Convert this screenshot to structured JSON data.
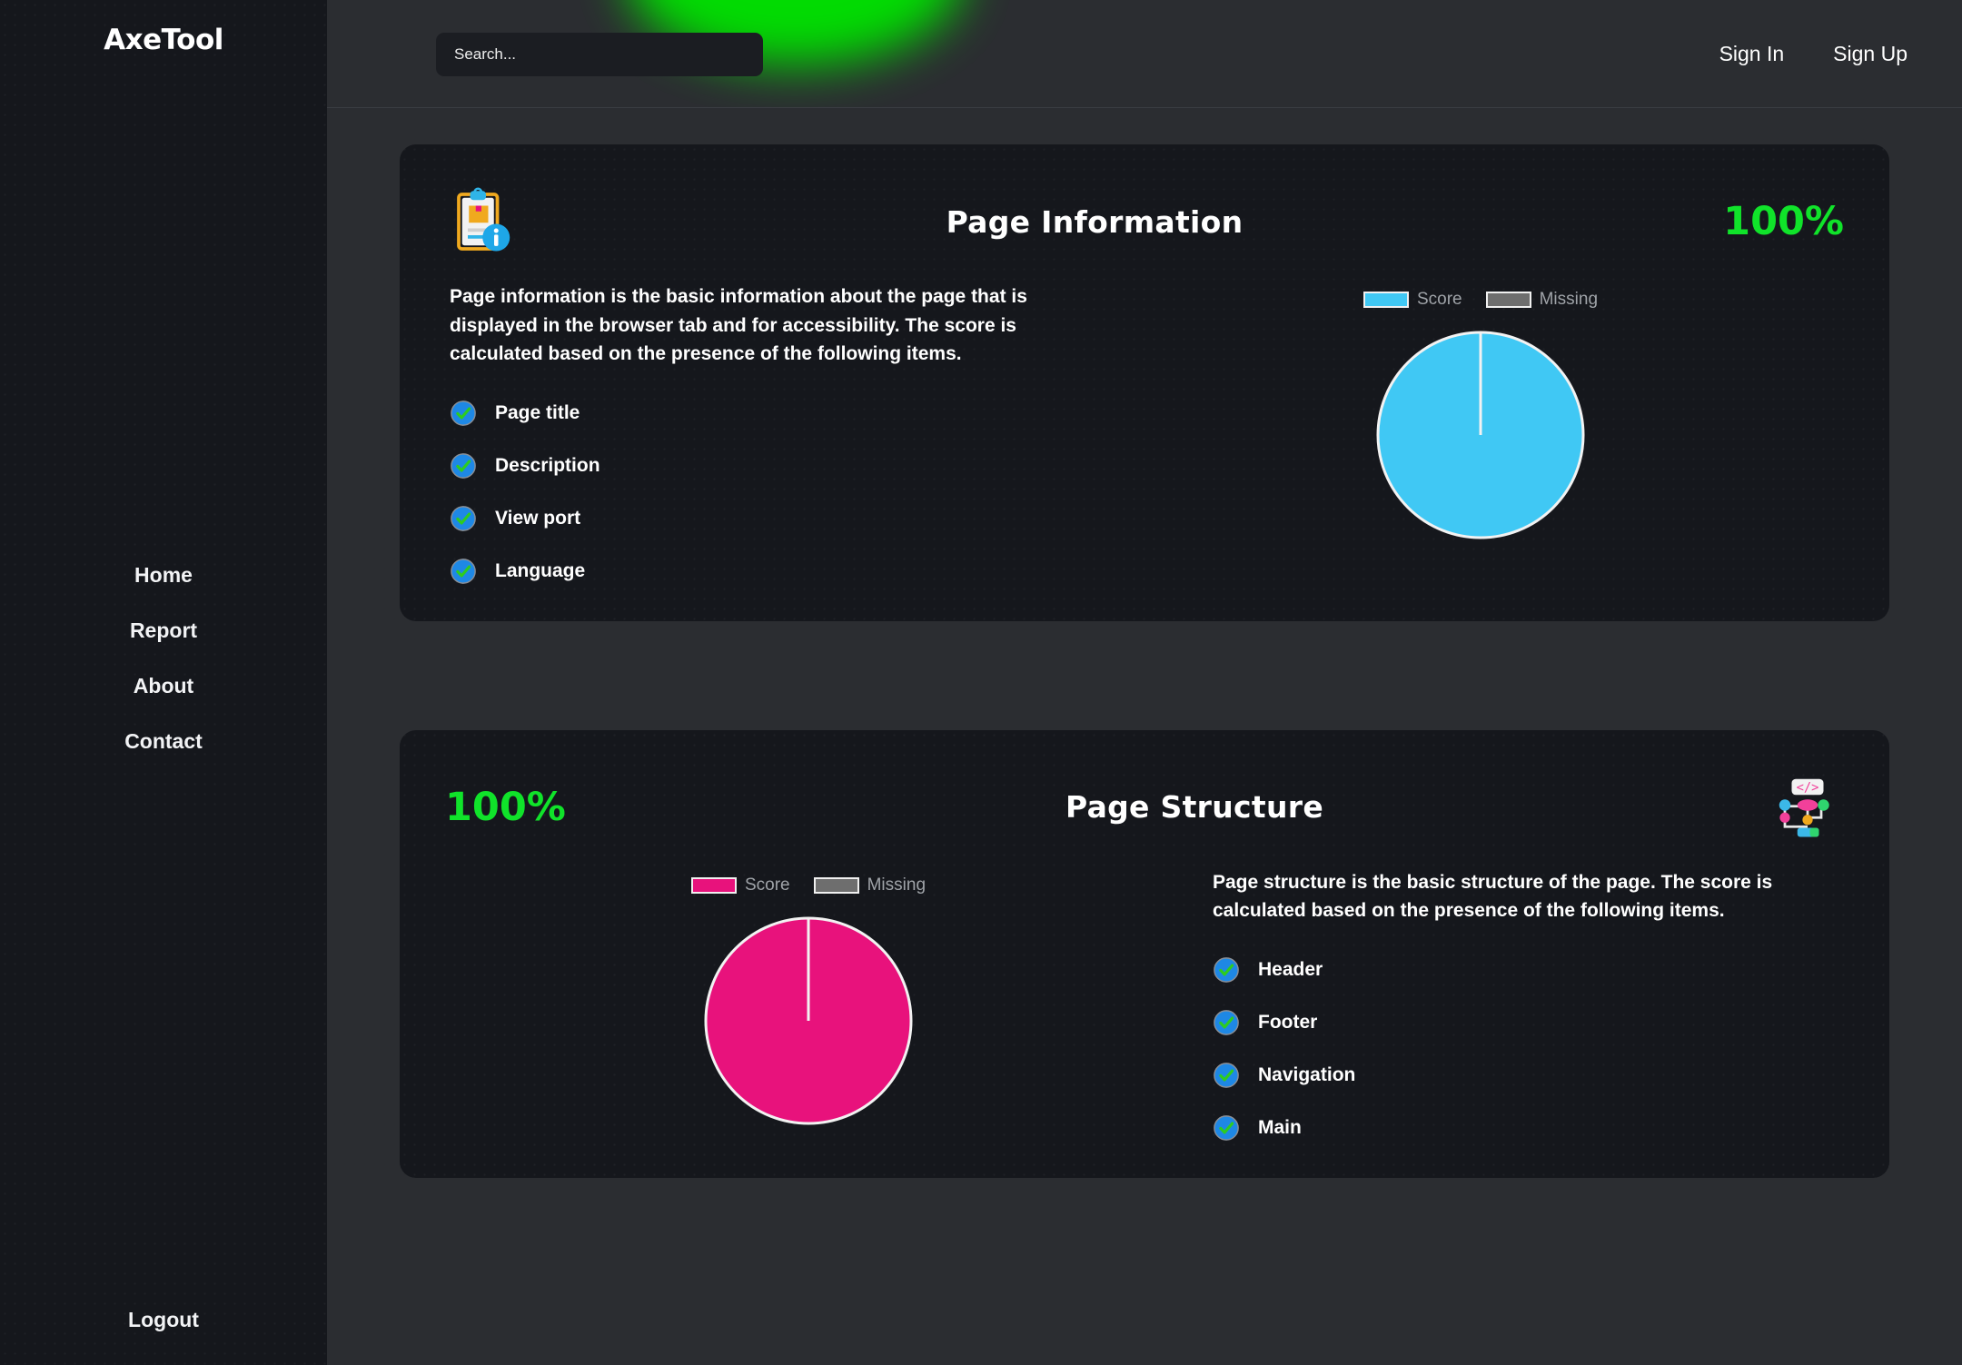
{
  "brand": {
    "name": "AxeTool"
  },
  "sidebar": {
    "items": [
      {
        "label": "Home",
        "name": "home"
      },
      {
        "label": "Report",
        "name": "report"
      },
      {
        "label": "About",
        "name": "about"
      },
      {
        "label": "Contact",
        "name": "contact"
      }
    ],
    "logout_label": "Logout"
  },
  "header": {
    "search": {
      "placeholder": "Search...",
      "value": ""
    },
    "sign_in_label": "Sign In",
    "sign_up_label": "Sign Up",
    "glow_color": "#00e500"
  },
  "colors": {
    "score_green": "#10e32a",
    "page_info_pie": "#40c8f4",
    "page_structure_pie": "#e8127c",
    "missing_gray": "#6e6e6e",
    "check_circle": "#1e88e5",
    "check_mark": "#2ecc1f"
  },
  "cards": [
    {
      "id": "page-information",
      "title": "Page Information",
      "score": "100%",
      "icon_name": "clipboard-info-icon",
      "description": "Page information is the basic information about the page that is displayed in the browser tab and for accessibility. The score is calculated based on the presence of the following items.",
      "items": [
        {
          "label": "Page title",
          "checked": true
        },
        {
          "label": "Description",
          "checked": true
        },
        {
          "label": "View port",
          "checked": true
        },
        {
          "label": "Language",
          "checked": true
        }
      ],
      "legend": [
        {
          "label": "Score",
          "color": "#40c8f4"
        },
        {
          "label": "Missing",
          "color": "#6e6e6e"
        }
      ]
    },
    {
      "id": "page-structure",
      "title": "Page Structure",
      "score": "100%",
      "icon_name": "sitemap-code-icon",
      "description": "Page structure is the basic structure of the page. The score is calculated based on the presence of the following items.",
      "items": [
        {
          "label": "Header",
          "checked": true
        },
        {
          "label": "Footer",
          "checked": true
        },
        {
          "label": "Navigation",
          "checked": true
        },
        {
          "label": "Main",
          "checked": true
        }
      ],
      "legend": [
        {
          "label": "Score",
          "color": "#e8127c"
        },
        {
          "label": "Missing",
          "color": "#6e6e6e"
        }
      ]
    }
  ],
  "chart_data": [
    {
      "type": "pie",
      "title": "Page Information",
      "categories": [
        "Score",
        "Missing"
      ],
      "values": [
        100,
        0
      ],
      "unit": "%",
      "colors": [
        "#40c8f4",
        "#6e6e6e"
      ],
      "legend_position": "top",
      "start_angle": 90,
      "radius_px": 113
    },
    {
      "type": "pie",
      "title": "Page Structure",
      "categories": [
        "Score",
        "Missing"
      ],
      "values": [
        100,
        0
      ],
      "unit": "%",
      "colors": [
        "#e8127c",
        "#6e6e6e"
      ],
      "legend_position": "top",
      "start_angle": 90,
      "radius_px": 113
    }
  ]
}
